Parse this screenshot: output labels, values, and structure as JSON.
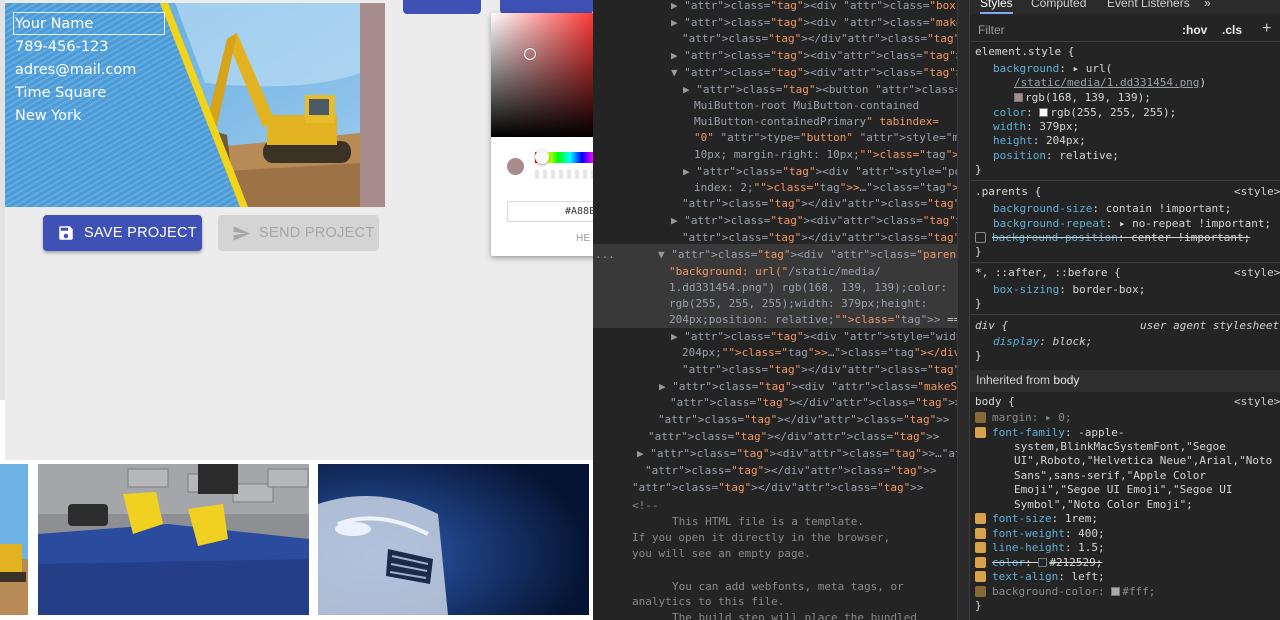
{
  "card": {
    "name": "Your Name",
    "phone": "789-456-123",
    "email": "adres@mail.com",
    "address": "Time Square",
    "city": "New York",
    "background_color": "#a88b8b"
  },
  "buttons": {
    "save_label": "SAVE PROJECT",
    "send_label": "SEND PROJECT",
    "primary_color": "#3f51b5"
  },
  "picker": {
    "hex_value": "#A88B",
    "hex_label": "HE"
  },
  "devtools": {
    "tabs": [
      "Styles",
      "Computed",
      "Event Listeners",
      "»"
    ],
    "filter_placeholder": "Filter",
    "hov": ":hov",
    "cls": ".cls",
    "plus": "+",
    "elements_lines": [
      {
        "t": "▶",
        "s": "<div class=\"box\">…</div>"
      },
      {
        "t": "▶",
        "s": "<div class=\"makeStyles-icon-131\">…"
      },
      {
        "t": "",
        "s": "</div>"
      },
      {
        "t": "▶",
        "s": "<div>…</div>"
      },
      {
        "t": "▼",
        "s": "<div>"
      },
      {
        "t": "▶",
        "s": "<button class=\"MuiButtonBase-root"
      },
      {
        "t": "",
        "s": "MuiButton-root MuiButton-contained"
      },
      {
        "t": "",
        "s": "MuiButton-containedPrimary\" tabindex="
      },
      {
        "t": "",
        "s": "\"0\" type=\"button\" style=\"margin-left:"
      },
      {
        "t": "",
        "s": "10px; margin-right: 10px;\">…</button>"
      },
      {
        "t": "▶",
        "s": "<div style=\"position: absolute; z-"
      },
      {
        "t": "",
        "s": "index: 2;\">…</div>"
      },
      {
        "t": "",
        "s": "</div>"
      },
      {
        "t": "▶",
        "s": "<div>…</div>"
      },
      {
        "t": "",
        "s": "</div>"
      },
      {
        "t": "▼",
        "s": "<div class=\"parents\" id=\"parents\" style="
      },
      {
        "t": "",
        "s": "\"background: url(\"/static/media/"
      },
      {
        "t": "",
        "s": "1.dd331454.png\") rgb(168, 139, 139);color:"
      },
      {
        "t": "",
        "s": "rgb(255, 255, 255);width: 379px;height:"
      },
      {
        "t": "",
        "s": "204px;position: relative;\"> == $0"
      },
      {
        "t": "▶",
        "s": "<div style=\"width: 355px; height:"
      },
      {
        "t": "",
        "s": "204px;\">…</div>"
      },
      {
        "t": "",
        "s": "</div>"
      },
      {
        "t": "▶",
        "s": "<div class=\"makeStyles-position-197\">…"
      },
      {
        "t": "",
        "s": "</div>"
      },
      {
        "t": "",
        "s": "</div>"
      },
      {
        "t": "",
        "s": "</div>"
      },
      {
        "t": "▶",
        "s": "<div>…</div>"
      },
      {
        "t": "",
        "s": "</div>"
      },
      {
        "t": "",
        "s": "</div>"
      },
      {
        "t": "",
        "s": "<!--"
      },
      {
        "t": "",
        "s": "This HTML file is a template."
      },
      {
        "t": "",
        "s": "If you open it directly in the browser,"
      },
      {
        "t": "",
        "s": "you will see an empty page."
      },
      {
        "t": "",
        "s": ""
      },
      {
        "t": "",
        "s": "You can add webfonts, meta tags, or"
      },
      {
        "t": "",
        "s": "analytics to this file."
      },
      {
        "t": "",
        "s": "The build step will place the bundled"
      }
    ],
    "ellipsis": "...",
    "rules": {
      "element_style": {
        "selector": "element.style {",
        "background_prop": "background",
        "background_url": "/static/media/1.dd331454.png",
        "background_rgb": "rgb(168, 139, 139);",
        "color_prop": "color",
        "color_val": "rgb(255, 255, 255);",
        "width_prop": "width",
        "width_val": "379px;",
        "height_prop": "height",
        "height_val": "204px;",
        "position_prop": "position",
        "position_val": "relative;"
      },
      "parents": {
        "selector": ".parents {",
        "source": "<style>",
        "bg_size": "contain !important;",
        "bg_repeat": "no-repeat !important;",
        "bg_position": "center !important;"
      },
      "universal": {
        "selector": "*, ::after, ::before {",
        "source": "<style>",
        "box_sizing": "border-box;"
      },
      "div": {
        "selector": "div {",
        "source": "user agent stylesheet",
        "display": "block;"
      },
      "inherited_label": "Inherited from",
      "inherited_from": "body",
      "body": {
        "selector": "body {",
        "source": "<style>",
        "margin": "0;",
        "font_family_1": "-apple-",
        "font_family_2": "system,BlinkMacSystemFont,\"Segoe",
        "font_family_3": "UI\",Roboto,\"Helvetica Neue\",Arial,\"Noto",
        "font_family_4": "Sans\",sans-serif,\"Apple Color",
        "font_family_5": "Emoji\",\"Segoe UI Emoji\",\"Segoe UI",
        "font_family_6": "Symbol\",\"Noto Color Emoji\";",
        "font_size": "1rem;",
        "font_weight": "400;",
        "line_height": "1.5;",
        "color": "#212529;",
        "text_align": "left;",
        "background_color": "#fff;"
      }
    }
  }
}
